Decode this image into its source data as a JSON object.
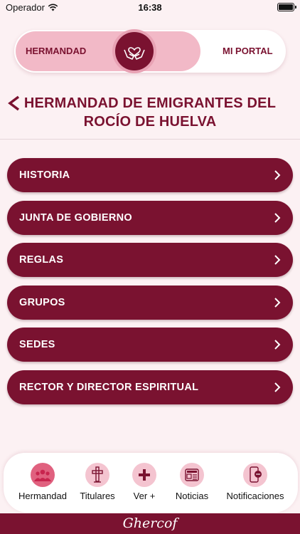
{
  "status_bar": {
    "carrier": "Operador",
    "time": "16:38"
  },
  "toggle": {
    "left_label": "HERMANDAD",
    "right_label": "MI PORTAL",
    "knob_icon": "heart-hands-icon"
  },
  "header": {
    "title": "HERMANDAD DE EMIGRANTES DEL ROCÍO DE HUELVA",
    "back_icon": "back-chevron-icon"
  },
  "menu": {
    "items": [
      {
        "label": "HISTORIA"
      },
      {
        "label": "JUNTA DE GOBIERNO"
      },
      {
        "label": "REGLAS"
      },
      {
        "label": "GRUPOS"
      },
      {
        "label": "SEDES"
      },
      {
        "label": "RECTOR Y DIRECTOR ESPIRITUAL"
      }
    ]
  },
  "tabbar": {
    "tabs": [
      {
        "label": "Hermandad",
        "icon": "people-group-icon",
        "active": true
      },
      {
        "label": "Titulares",
        "icon": "cross-icon",
        "active": false
      },
      {
        "label": "Ver +",
        "icon": "plus-icon",
        "active": false
      },
      {
        "label": "Noticias",
        "icon": "newspaper-icon",
        "active": false
      },
      {
        "label": "Notificaciones",
        "icon": "phone-chat-icon",
        "active": false
      }
    ]
  },
  "footer": {
    "brand": "Ghercof"
  },
  "colors": {
    "primary": "#7a1230",
    "accent_pink": "#f2b9c7",
    "background": "#fcf1f3",
    "active_tab": "#e0617f"
  }
}
